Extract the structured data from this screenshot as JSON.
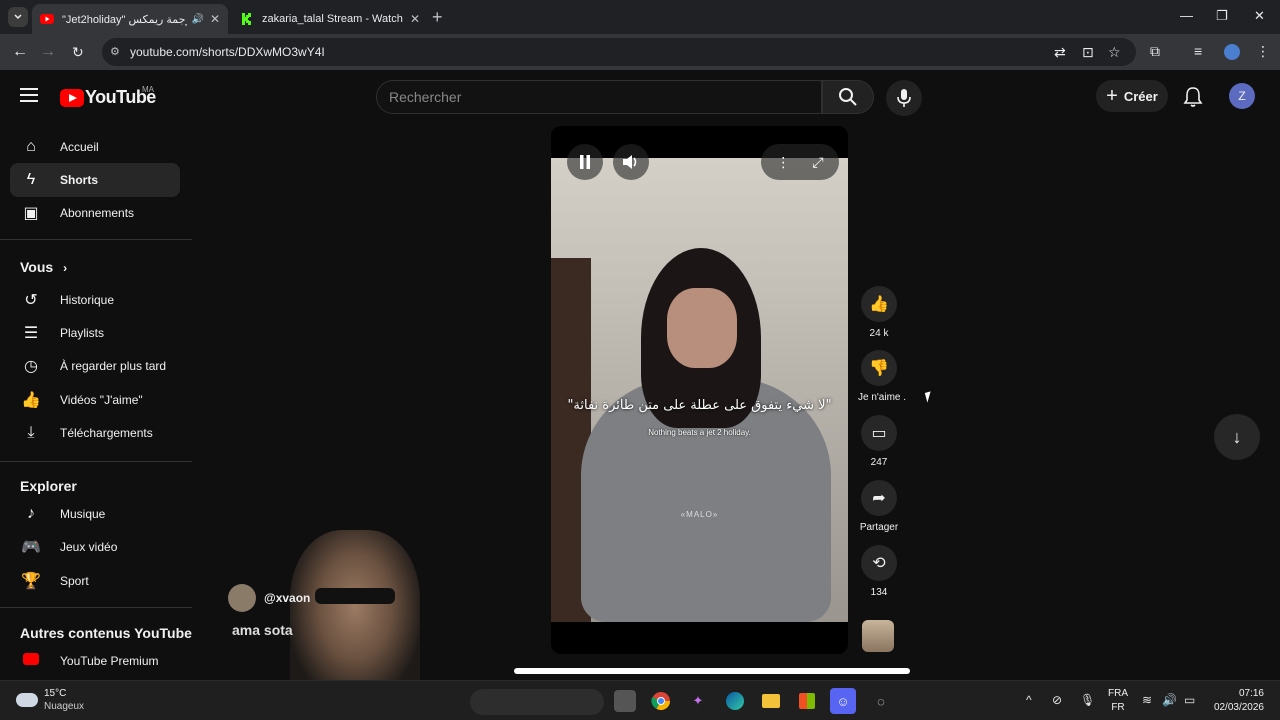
{
  "browser": {
    "tabs": [
      {
        "title": "\"Jet2holiday\" ترجمة ريمكس",
        "close": "✕"
      },
      {
        "title": "zakaria_talal Stream - Watch Li",
        "close": "✕"
      }
    ],
    "new_tab": "+",
    "url": "youtube.com/shorts/DDXwMO3wY4I",
    "window_controls": {
      "minimize": "—",
      "maximize": "❐",
      "close": "✕"
    }
  },
  "header": {
    "logo_text": "YouTube",
    "country": "MA",
    "search_placeholder": "Rechercher",
    "create_label": "Créer",
    "avatar_letter": "Z"
  },
  "sidebar": {
    "main": [
      {
        "label": "Accueil",
        "icon": "home-icon"
      },
      {
        "label": "Shorts",
        "icon": "shorts-icon"
      },
      {
        "label": "Abonnements",
        "icon": "subscriptions-icon"
      }
    ],
    "you_heading": "Vous",
    "you": [
      {
        "label": "Historique",
        "icon": "history-icon"
      },
      {
        "label": "Playlists",
        "icon": "playlists-icon"
      },
      {
        "label": "À regarder plus tard",
        "icon": "watch-later-icon"
      },
      {
        "label": "Vidéos \"J'aime\"",
        "icon": "liked-icon"
      },
      {
        "label": "Téléchargements",
        "icon": "download-icon"
      }
    ],
    "explore_heading": "Explorer",
    "explore": [
      {
        "label": "Musique",
        "icon": "music-icon"
      },
      {
        "label": "Jeux vidéo",
        "icon": "gaming-icon"
      },
      {
        "label": "Sport",
        "icon": "trophy-icon"
      }
    ],
    "more_heading": "Autres contenus YouTube",
    "more": [
      {
        "label": "YouTube Premium",
        "icon": "youtube-premium-icon"
      }
    ]
  },
  "short": {
    "caption_arabic": "\"لا شيء يتفوق على عطلة على متن طائرة نفاثة\"",
    "caption_english": "Nothing beats a jet 2 holiday.",
    "shirt_text": "«MALO»",
    "likes": "24 k",
    "dislike_label": "Je n'aime .",
    "comments": "247",
    "share_label": "Partager",
    "remix_count": "134"
  },
  "overlay": {
    "username": "@xvaon",
    "message": "ama sota"
  },
  "taskbar": {
    "temperature": "15°C",
    "weather": "Nuageux",
    "lang_top": "FRA",
    "lang_bottom": "FR",
    "time": "07:16",
    "date": "02/03/2026"
  },
  "colors": {
    "brand": "#ff0000",
    "background": "#0f0f0f",
    "avatar": "#5c6bc0"
  }
}
